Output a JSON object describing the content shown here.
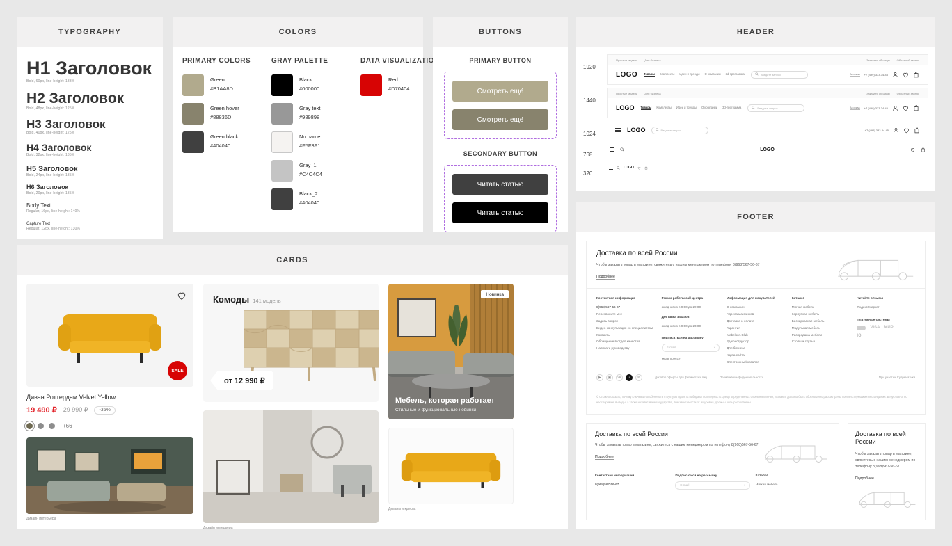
{
  "panels": {
    "typography": "TYPOGRAPHY",
    "colors": "COLORS",
    "buttons": "BUTTONS",
    "header": "HEADER",
    "footer": "FOOTER",
    "cards": "CARDS"
  },
  "typography": {
    "items": [
      {
        "title": "H1 Заголовок",
        "meta": "Bold, 60px, line-height: 133%"
      },
      {
        "title": "H2 Заголовок",
        "meta": "Bold, 48px, line-height: 125%"
      },
      {
        "title": "H3 Заголовок",
        "meta": "Bold, 40px, line-height: 125%"
      },
      {
        "title": "H4 Заголовок",
        "meta": "Bold, 32px, line-height: 135%"
      },
      {
        "title": "H5 Заголовок",
        "meta": "Bold, 24px, line-height: 135%"
      },
      {
        "title": "H6 Заголовок",
        "meta": "Bold, 20px, line-height: 135%"
      },
      {
        "title": "Body Text",
        "meta": "Regular, 16px, line-height: 140%"
      },
      {
        "title": "Capture Text",
        "meta": "Regular, 12px, line-height: 130%"
      }
    ]
  },
  "colors": {
    "groups": [
      {
        "heading": "PRIMARY COLORS",
        "swatches": [
          {
            "name": "Green",
            "hex": "#B1AA8D",
            "value": "#B1AA8D",
            "bordered": false
          },
          {
            "name": "Green hover",
            "hex": "#88836D",
            "value": "#88836D",
            "bordered": false
          },
          {
            "name": "Green black",
            "hex": "#404040",
            "value": "#404040",
            "bordered": false
          }
        ]
      },
      {
        "heading": "GRAY PALETTE",
        "swatches": [
          {
            "name": "Black",
            "hex": "#000000",
            "value": "#000000",
            "bordered": false
          },
          {
            "name": "Gray text",
            "hex": "#989898",
            "value": "#989898",
            "bordered": false
          },
          {
            "name": "No name",
            "hex": "#F5F3F1",
            "value": "#F5F3F1",
            "bordered": true
          },
          {
            "name": "Gray_1",
            "hex": "#C4C4C4",
            "value": "#C4C4C4",
            "bordered": false
          },
          {
            "name": "Black_2",
            "hex": "#404040",
            "value": "#404040",
            "bordered": false
          }
        ]
      },
      {
        "heading": "DATA VISUALIZATION",
        "swatches": [
          {
            "name": "Red",
            "hex": "#D70404",
            "value": "#D70404",
            "bordered": false
          }
        ]
      }
    ]
  },
  "buttons": {
    "primary_heading": "PRIMARY BUTTON",
    "secondary_heading": "SECONDARY BUTTON",
    "primary_label": "Смотреть ещё",
    "primary_hover_label": "Смотреть ещё",
    "secondary_label": "Читать статью",
    "secondary_hover_label": "Читать статью"
  },
  "header": {
    "breakpoints": [
      "1920",
      "1440",
      "1024",
      "768",
      "320"
    ],
    "logo": "LOGO",
    "top_links": [
      "Простые модели",
      "Для бизнеса"
    ],
    "top_links_right": [
      "Заказать образцы",
      "Обратный звонок"
    ],
    "nav": [
      "Товары",
      "Комплекты",
      "Идеи и тренды",
      "О компании",
      "3d-программа"
    ],
    "search_placeholder": "Введите запрос",
    "city": "Москва",
    "phone": "+7 (499) 333-34-45"
  },
  "cards": {
    "product": {
      "name": "Диван Роттердам Velvet Yellow",
      "price_new": "19 490 ₽",
      "price_old": "29 990 ₽",
      "discount": "-35%",
      "colors_more": "+66",
      "sale_badge": "SALE"
    },
    "room_caption": "Дизайн интерьера",
    "category": {
      "title": "Комоды",
      "count": "141 модель",
      "price_from": "от 12 990 ₽"
    },
    "promo": {
      "badge": "Новинка",
      "title": "Мебель, которая работает",
      "subtitle": "Стильные и функциональные новинки"
    },
    "sofa_caption": "Диваны и кресла"
  },
  "footer": {
    "hero": {
      "title": "Доставка по всей России",
      "text": "Чтобы заказать товар в магазине, свяжитесь с нашим менеджером по телефону 8(968)567-56-67",
      "link": "Подробнее"
    },
    "columns": [
      {
        "heading": "Контактная информация",
        "items": [
          "8(968)567-56-67",
          "Перезвоните мне",
          "Задать вопрос",
          "Видео консультация со специалистом",
          "Контакты",
          "Обращение в отдел качества",
          "Написать руководству"
        ]
      },
      {
        "heading": "Режим работы call-центра",
        "items": [
          "ежедневно с 9:00 до 22:00",
          "Доставка заказов",
          "ежедневно с 9:00 до 23:00"
        ],
        "subscribe_heading": "Подписаться на рассылку",
        "subscribe_placeholder": "E-mail",
        "press_link": "Мы в прессе"
      },
      {
        "heading": "Информация для покупателей",
        "items": [
          "О компании",
          "Адреса магазинов",
          "Доставка и оплата",
          "Гарантия",
          "Mebelson.Club",
          "3д-конструктор",
          "Для бизнеса",
          "Карта сайта",
          "Электронный каталог"
        ]
      },
      {
        "heading": "Каталог",
        "items": [
          "Мягкая мебель",
          "Корпусная мебель",
          "Бескаркасная мебель",
          "Модульная мебель",
          "Распродажа мебели",
          "Столы и стулья"
        ]
      },
      {
        "heading": "Читайте отзывы",
        "items": [
          "Яндекс Маркет"
        ],
        "payment_heading": "Платежные системы",
        "payment_labels": [
          "VISA",
          "МИР",
          "Ю"
        ]
      }
    ],
    "socials": [
      "youtube-icon",
      "instagram-icon",
      "vk-icon",
      "tiktok-icon",
      "pinterest-icon"
    ],
    "legal_links": [
      "Договор оферты для физических лиц",
      "Политика конфиденциальности",
      "При участии Супрематики"
    ],
    "legal_text": "© Сложно сказать, почему ключевые особенности структуры проекта набирают популярность среди определенных слоев населения, а значит, должны быть обоснованно рассмотрены соответствующими инстанциями. Безусловно, но неоспоримые выводы, а также независимые государства, вне зависимости от их уровня, должны быть разоблачены.",
    "card_tablet": {
      "title": "Доставка по всей России",
      "text": "Чтобы заказать товар в магазине, свяжитесь с нашим менеджером по телефону 8(968)567-56-67",
      "link": "Подробнее",
      "col1_heading": "Контактная информация",
      "col1_item": "8(968)567-56-67",
      "col2_heading": "Подписаться на рассылку",
      "col2_placeholder": "E-mail",
      "col3_heading": "Каталог",
      "col3_item": "Мягкая мебель"
    },
    "card_mobile": {
      "title": "Доставка по всей России",
      "text": "Чтобы заказать товар в магазине, свяжитесь с нашим менеджером по телефону 8(968)567-56-67",
      "link": "Подробнее"
    }
  }
}
